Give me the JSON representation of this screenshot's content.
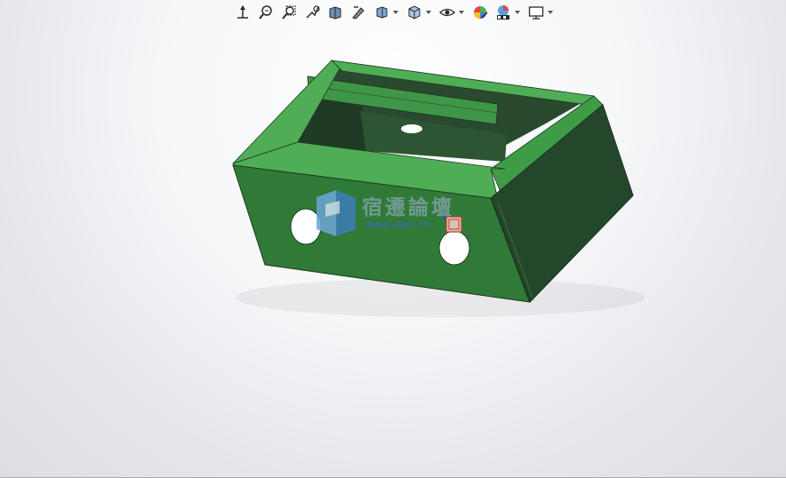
{
  "toolbar": {
    "items": [
      {
        "icon": "view-orient-icon",
        "dropdown": false
      },
      {
        "icon": "zoom-to-fit-icon",
        "dropdown": false
      },
      {
        "icon": "zoom-to-area-icon",
        "dropdown": false
      },
      {
        "icon": "previous-view-icon",
        "dropdown": false
      },
      {
        "icon": "section-view-icon",
        "dropdown": false
      },
      {
        "icon": "dynamic-annotation-icon",
        "dropdown": false
      },
      {
        "icon": "view-orientation-icon",
        "dropdown": true
      },
      {
        "icon": "display-style-icon",
        "dropdown": true
      },
      {
        "icon": "hide-show-items-icon",
        "dropdown": true
      },
      {
        "icon": "edit-appearance-icon",
        "dropdown": false
      },
      {
        "icon": "apply-scene-icon",
        "dropdown": true
      },
      {
        "icon": "view-settings-icon",
        "dropdown": true
      }
    ]
  },
  "model": {
    "color_top": "#4fae55",
    "color_front": "#2f7a36",
    "color_side": "#24472c",
    "color_inner": "#2a4a30"
  },
  "watermark": {
    "title": "宿遷論壇",
    "url": "www.sqee.cn"
  }
}
